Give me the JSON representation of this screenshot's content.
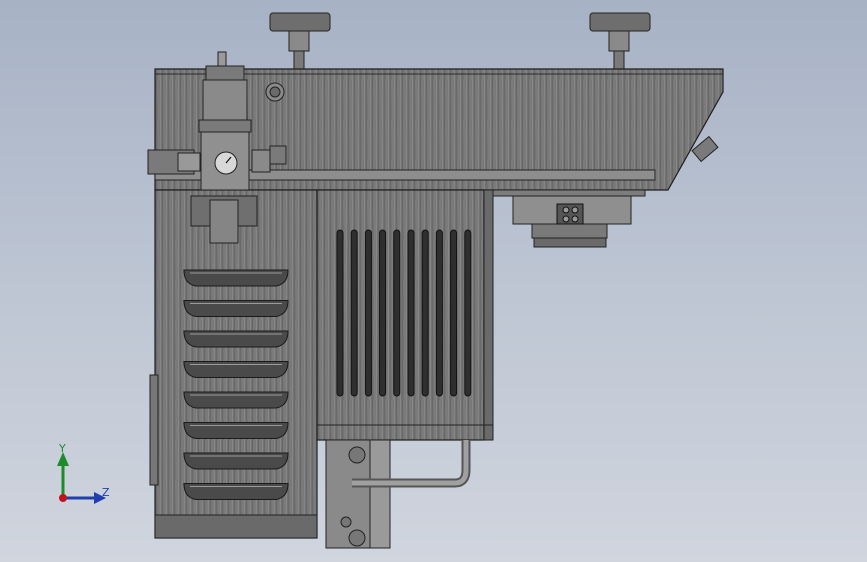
{
  "viewport": {
    "background_top": "#a7b2c5",
    "background_bottom": "#d0d5de"
  },
  "model": {
    "body_color": "#6f6f6f",
    "edge_color": "#2a2a2a",
    "highlight_color": "#a4a4a4"
  },
  "triad": {
    "y_label": "Y",
    "z_label": "Z",
    "y_color": "#1c8c2a",
    "z_color": "#1f3fb0",
    "origin_color": "#c2121b"
  }
}
